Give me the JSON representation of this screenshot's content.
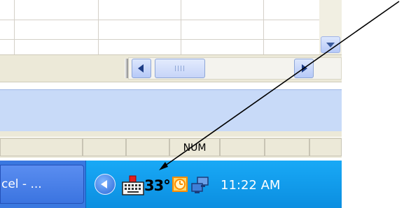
{
  "status_bar": {
    "num_indicator": "NUM"
  },
  "taskbar": {
    "task_button_label": "cel - ...",
    "tray_temperature": "33°",
    "clock_time": "11:22 AM"
  },
  "icons": [
    "scroll-down-icon",
    "scroll-left-icon",
    "scroll-right-icon",
    "tray-chevron-icon",
    "keyboard-icon",
    "clock-icon",
    "network-icon"
  ],
  "colors": {
    "taskbar_blue": "#3a78e0",
    "tray_blue": "#0b8ee0",
    "task_pane_blue": "#c8daf8",
    "chrome_beige": "#ece9d8"
  }
}
